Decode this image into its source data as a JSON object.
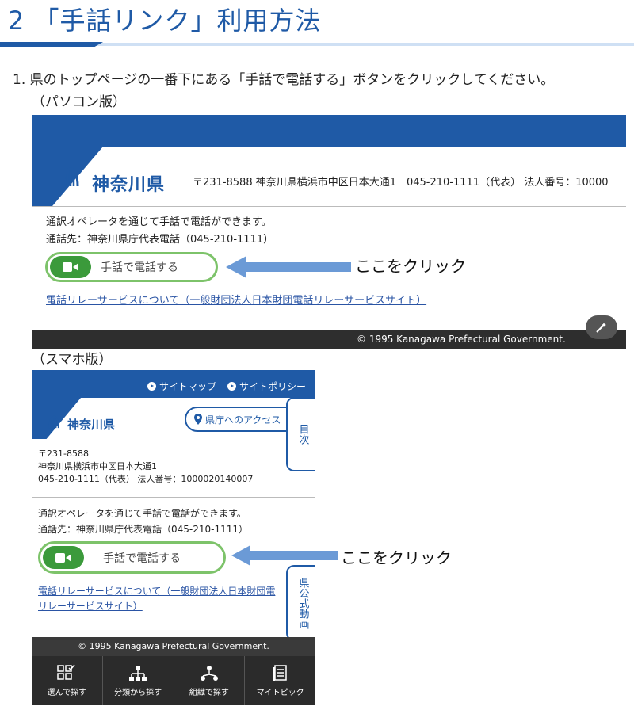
{
  "section": {
    "title": "2 「手話リンク」利用方法"
  },
  "step1": {
    "text": "1. 県のトップページの一番下にある「手話で電話する」ボタンをクリックしてください。"
  },
  "pc": {
    "caption": "（パソコン版）",
    "pref_name": "神奈川県",
    "address": "〒231-8588 神奈川県横浜市中区日本大通1　045-210-1111（代表） 法人番号：10000",
    "desc1": "通訳オペレータを通じて手話で電話ができます。",
    "desc2": "通話先：神奈川県庁代表電話（045-210-1111）",
    "button_label": "手話で電話する",
    "click_label": "ここをクリック",
    "relay_link": "電話リレーサービスについて（一般財団法人日本財団電話リレーサービスサイト）",
    "copyright": "© 1995 Kanagawa Prefectural Government."
  },
  "sp": {
    "caption": "（スマホ版）",
    "nav_sitemap": "サイトマップ",
    "nav_policy": "サイトポリシー",
    "pref_name": "神奈川県",
    "access_button": "県庁へのアクセス",
    "side_tab_top": "目次",
    "side_tab_bottom": "県公式動画",
    "address_line1": "〒231-8588",
    "address_line2": "神奈川県横浜市中区日本大通1",
    "address_line3": "045-210-1111（代表） 法人番号：1000020140007",
    "desc1": "通訳オペレータを通じて手話で電話ができます。",
    "desc2": "通話先：神奈川県庁代表電話（045-210-1111）",
    "button_label": "手話で電話する",
    "click_label": "ここをクリック",
    "relay_link_line1": "電話リレーサービスについて（一般財団法人日本財団電",
    "relay_link_line2": "リレーサービスサイト）",
    "copyright": "© 1995 Kanagawa Prefectural Government.",
    "bottom_nav": [
      "選んで探す",
      "分類から探す",
      "組織で探す",
      "マイトピック"
    ]
  },
  "colors": {
    "brand_blue": "#1f5aa6",
    "button_green": "#7dc36a",
    "camera_green": "#3b9a3b",
    "arrow_blue": "#6b9ad6"
  },
  "icons": [
    "kanagawa-logo-icon",
    "video-camera-icon",
    "arrow-left-icon",
    "edit-wand-icon",
    "location-pin-icon",
    "select-grid-icon",
    "category-tree-icon",
    "organization-icon",
    "my-topic-icon"
  ]
}
